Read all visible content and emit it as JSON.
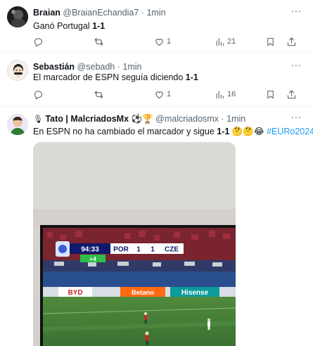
{
  "tweets": [
    {
      "name": "Braian",
      "handle": "@BraianEchandia7",
      "time": "1min",
      "text_plain": "Ganó Portugal ",
      "text_bold": "1-1",
      "likes": "1",
      "views": "21"
    },
    {
      "name": "Sebastián",
      "handle": "@sebadh",
      "time": "1min",
      "text_plain": "El marcador de ESPN seguía diciendo ",
      "text_bold": "1-1",
      "likes": "1",
      "views": "16"
    },
    {
      "name_prefix": "🎙",
      "name": "Tato | MalcriadosMx",
      "name_suffix": "⚽🏆",
      "handle": "@malcriadosmx",
      "time": "1min",
      "text_plain": "En ESPN no ha cambiado el marcador y sigue ",
      "text_bold": "1-1",
      "text_emojis": "🤔🤔😂",
      "hashtag": "#EURo2024",
      "hashtag_emoji": "⚽"
    }
  ],
  "separator": "·",
  "more_label": "···",
  "scoreboard": {
    "clock": "94:33",
    "added_time": "+4",
    "home": "POR",
    "home_score": "1",
    "away_score": "1",
    "away": "CZE"
  },
  "ads": {
    "byd": "BYD",
    "betano": "Betano",
    "hisense": "Hisense"
  },
  "colors": {
    "text": "#0f1419",
    "secondary": "#536471",
    "link": "#1d9bf0",
    "divider": "#eff3f4"
  },
  "icons": [
    "reply-icon",
    "retweet-icon",
    "like-icon",
    "views-icon",
    "bookmark-icon",
    "share-icon",
    "more-icon"
  ]
}
